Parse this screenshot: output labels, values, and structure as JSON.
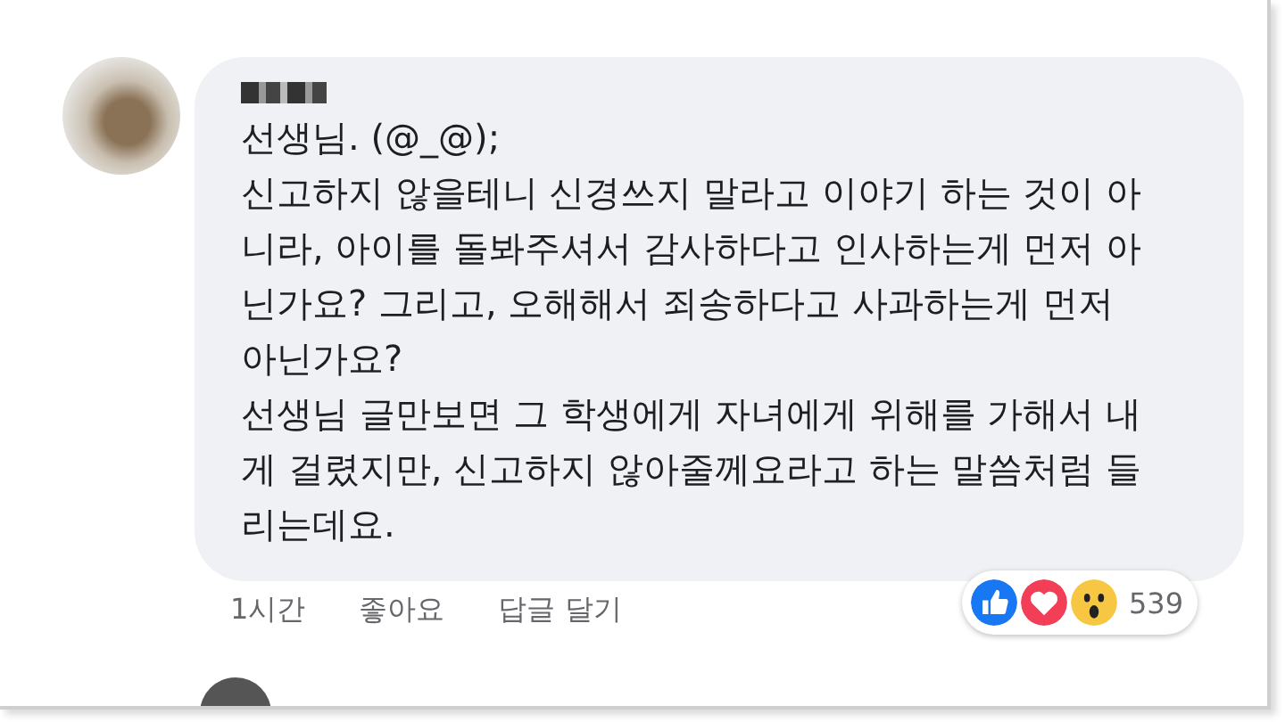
{
  "comment": {
    "paragraphs": [
      "선생님. (@_@);",
      "신고하지 않을테니 신경쓰지 말라고 이야기 하는 것이 아니라, 아이를 돌봐주셔서 감사하다고 인사하는게 먼저 아닌가요? 그리고, 오해해서 죄송하다고 사과하는게 먼저 아닌가요?",
      "선생님 글만보면 그 학생에게 자녀에게 위해를 가해서 내게 걸렸지만, 신고하지 않아줄께요라고 하는 말씀처럼 들리는데요."
    ],
    "time": "1시간",
    "actions": [
      "좋아요",
      "답글 달기"
    ],
    "reactions": {
      "items": [
        {
          "kind": "like"
        },
        {
          "kind": "love"
        },
        {
          "kind": "wow"
        }
      ],
      "count": "539"
    }
  }
}
